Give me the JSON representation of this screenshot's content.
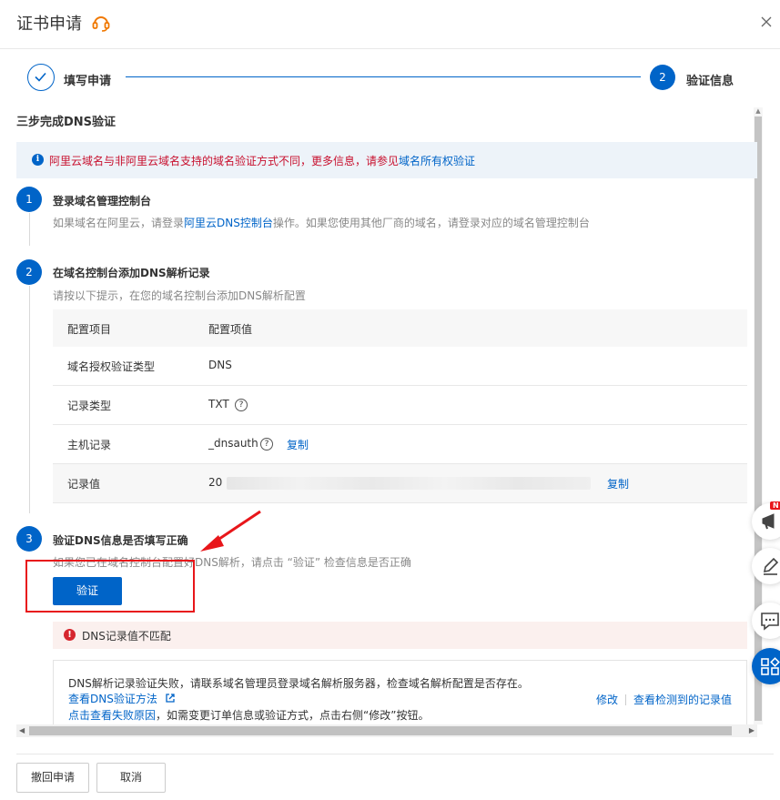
{
  "header": {
    "title": "证书申请"
  },
  "steps": {
    "step1_label": "填写申请",
    "step2_number": "2",
    "step2_label": "验证信息"
  },
  "section_title": "三步完成DNS验证",
  "info_bar": {
    "text": "阿里云域名与非阿里云域名支持的域名验证方式不同，更多信息，请参见",
    "link": "域名所有权验证"
  },
  "step_one": {
    "number": "1",
    "heading": "登录域名管理控制台",
    "desc_prefix": "如果域名在阿里云，请登录",
    "desc_link": "阿里云DNS控制台",
    "desc_suffix": "操作。如果您使用其他厂商的域名，请登录对应的域名管理控制台"
  },
  "step_two": {
    "number": "2",
    "heading": "在域名控制台添加DNS解析记录",
    "desc": "请按以下提示，在您的域名控制台添加DNS解析配置"
  },
  "config_table": {
    "col_key": "配置项目",
    "col_val": "配置项值",
    "rows": [
      {
        "key": "域名授权验证类型",
        "value": "DNS"
      },
      {
        "key": "记录类型",
        "value": "TXT"
      },
      {
        "key": "主机记录",
        "value": "_dnsauth"
      },
      {
        "key": "记录值",
        "value": "20"
      }
    ],
    "copy_label": "复制",
    "help_glyph": "?"
  },
  "step_three": {
    "number": "3",
    "heading": "验证DNS信息是否填写正确",
    "desc": "如果您已在域名控制台配置好DNS解析，请点击 “验证” 检查信息是否正确",
    "verify_label": "验证"
  },
  "error": {
    "text": "DNS记录值不匹配"
  },
  "detail": {
    "line1": "DNS解析记录验证失败，请联系域名管理员登录域名解析服务器，检查域名解析配置是否存在。",
    "link_method": "查看DNS验证方法",
    "link_reason": "点击查看失败原因",
    "line3_suffix": "，如需变更订单信息或验证方式，点击右侧“修改”按钮。",
    "action_edit": "修改",
    "action_records": "查看检测到的记录值"
  },
  "footer": {
    "withdraw_label": "撤回申请",
    "cancel_label": "取消"
  },
  "floating": {
    "badge": "N"
  },
  "colors": {
    "primary": "#0064c8",
    "danger": "#e8161a",
    "warn_text": "#c8102e"
  }
}
